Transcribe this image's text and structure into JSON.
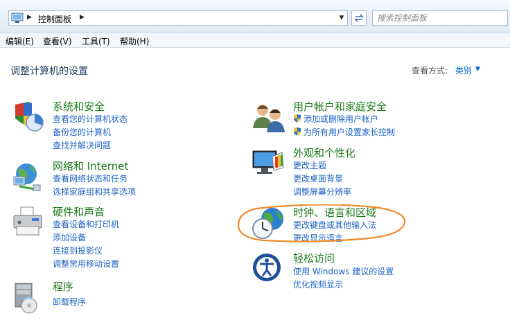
{
  "addressbar": {
    "breadcrumb": "控制面板",
    "search_placeholder": "搜索控制面板"
  },
  "menubar": {
    "items": [
      "编辑(E)",
      "查看(V)",
      "工具(T)",
      "帮助(H)"
    ]
  },
  "header": {
    "title": "调整计算机的设置",
    "viewby_label": "查看方式:",
    "viewby_value": "类别"
  },
  "categories": [
    {
      "title": "系统和安全",
      "icon": "shield-icon",
      "links": [
        "查看您的计算机状态",
        "备份您的计算机",
        "查找并解决问题"
      ]
    },
    {
      "title": "网络和 Internet",
      "icon": "network-icon",
      "links": [
        "查看网络状态和任务",
        "选择家庭组和共享选项"
      ]
    },
    {
      "title": "硬件和声音",
      "icon": "printer-icon",
      "links": [
        "查看设备和打印机",
        "添加设备",
        "连接到投影仪",
        "调整常用移动设置"
      ]
    },
    {
      "title": "程序",
      "icon": "programs-icon",
      "links": [
        "卸载程序"
      ]
    },
    {
      "title": "用户帐户和家庭安全",
      "icon": "users-icon",
      "links": [
        "添加或删除用户帐户",
        "为所有用户设置家长控制"
      ]
    },
    {
      "title": "外观和个性化",
      "icon": "monitor-palette-icon",
      "links": [
        "更改主题",
        "更改桌面背景",
        "调整屏幕分辨率"
      ]
    },
    {
      "title": "时钟、语言和区域",
      "icon": "clock-globe-icon",
      "links": [
        "更改键盘或其他输入法",
        "更改显示语言"
      ]
    },
    {
      "title": "轻松访问",
      "icon": "ease-of-access-icon",
      "links": [
        "使用 Windows 建议的设置",
        "优化视频显示"
      ]
    }
  ],
  "colors": {
    "category_title": "#1a7a1a",
    "link": "#1b62c2",
    "annotation": "#ef8a2a"
  }
}
